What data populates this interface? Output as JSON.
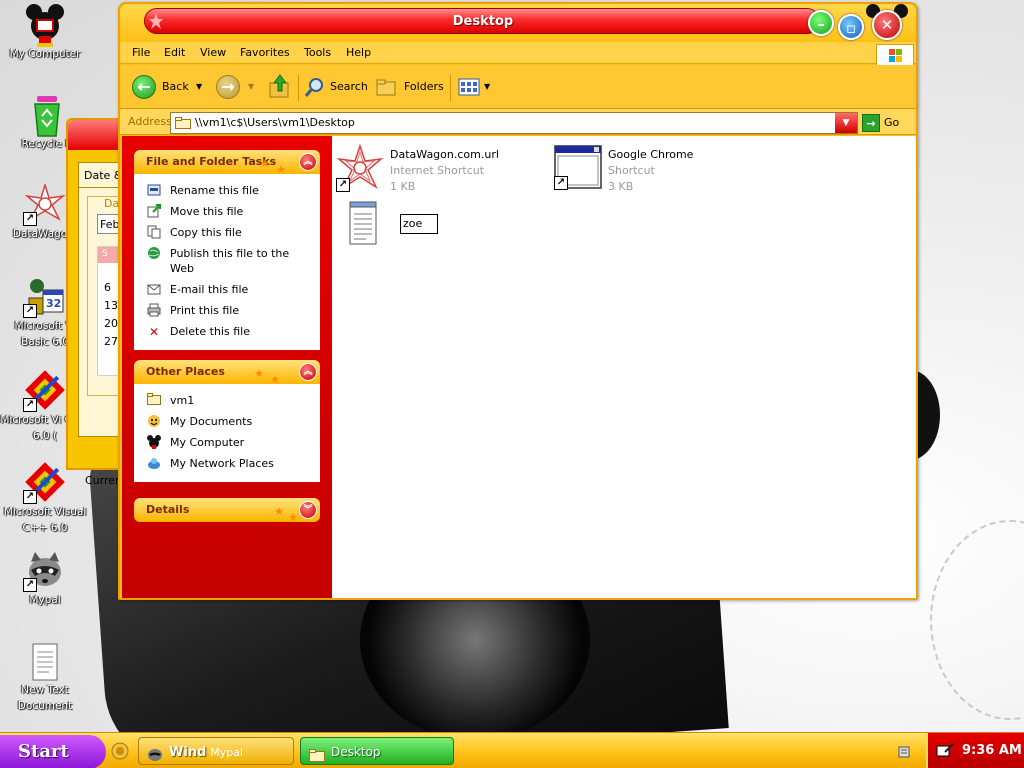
{
  "desktop": {
    "icons": [
      {
        "label": "My Computer",
        "icon": "mickey-computer-icon"
      },
      {
        "label": "Recycle B",
        "icon": "recycle-bin-icon"
      },
      {
        "label": "DataWagon.",
        "icon": "datawagon-star-icon"
      },
      {
        "label": "Microsoft Vi Basic 6.0",
        "icon": "visual-basic-icon"
      },
      {
        "label": "Microsoft Vi C++ 6.0 (",
        "icon": "visual-cpp-icon"
      },
      {
        "label": "Microsoft Visual C++ 6.0",
        "icon": "visual-cpp-icon"
      },
      {
        "label": "Mypal",
        "icon": "raccoon-icon"
      },
      {
        "label": "New Text Document",
        "icon": "notepad-icon"
      }
    ]
  },
  "background_window": {
    "tab": "Date &",
    "group_label": "Date",
    "month": "Feb",
    "cal_header": "S",
    "cal_rows": [
      "6",
      "13",
      "20",
      "27"
    ],
    "current": "Curren"
  },
  "window": {
    "title": "Desktop",
    "menu": [
      "File",
      "Edit",
      "View",
      "Favorites",
      "Tools",
      "Help"
    ],
    "toolbar": {
      "back": "Back",
      "search": "Search",
      "folders": "Folders"
    },
    "address": {
      "label": "Address",
      "value": "\\\\vm1\\c$\\Users\\vm1\\Desktop",
      "go": "Go"
    },
    "tasks": {
      "file_folder": {
        "title": "File and Folder Tasks",
        "links": [
          {
            "label": "Rename this file",
            "icon": "rename-icon"
          },
          {
            "label": "Move this file",
            "icon": "move-icon"
          },
          {
            "label": "Copy this file",
            "icon": "copy-icon"
          },
          {
            "label": "Publish this file to the Web",
            "icon": "globe-icon"
          },
          {
            "label": "E-mail this file",
            "icon": "email-icon"
          },
          {
            "label": "Print this file",
            "icon": "printer-icon"
          },
          {
            "label": "Delete this file",
            "icon": "delete-x-icon"
          }
        ]
      },
      "other_places": {
        "title": "Other Places",
        "links": [
          {
            "label": "vm1",
            "icon": "folder-icon"
          },
          {
            "label": "My Documents",
            "icon": "my-documents-icon"
          },
          {
            "label": "My Computer",
            "icon": "mickey-computer-icon"
          },
          {
            "label": "My Network Places",
            "icon": "network-icon"
          }
        ]
      },
      "details": {
        "title": "Details"
      }
    },
    "files": [
      {
        "name": "DataWagon.com.url",
        "type": "Internet Shortcut",
        "size": "1 KB"
      },
      {
        "name": "Google Chrome",
        "type": "Shortcut",
        "size": "3 KB"
      },
      {
        "name": "",
        "rename_value": "zoe"
      }
    ]
  },
  "taskbar": {
    "start": "Start",
    "tasks": [
      {
        "label": "Wind",
        "sublabel": "Mypal",
        "active": false
      },
      {
        "label": "Desktop",
        "active": true
      }
    ],
    "clock": "9:36 AM"
  },
  "colors": {
    "window_frame": "#ffbf1a",
    "title_red": "#e30000",
    "task_pane_red": "#d40000",
    "start_purple": "#a020e0",
    "active_task_green": "#38c838"
  }
}
